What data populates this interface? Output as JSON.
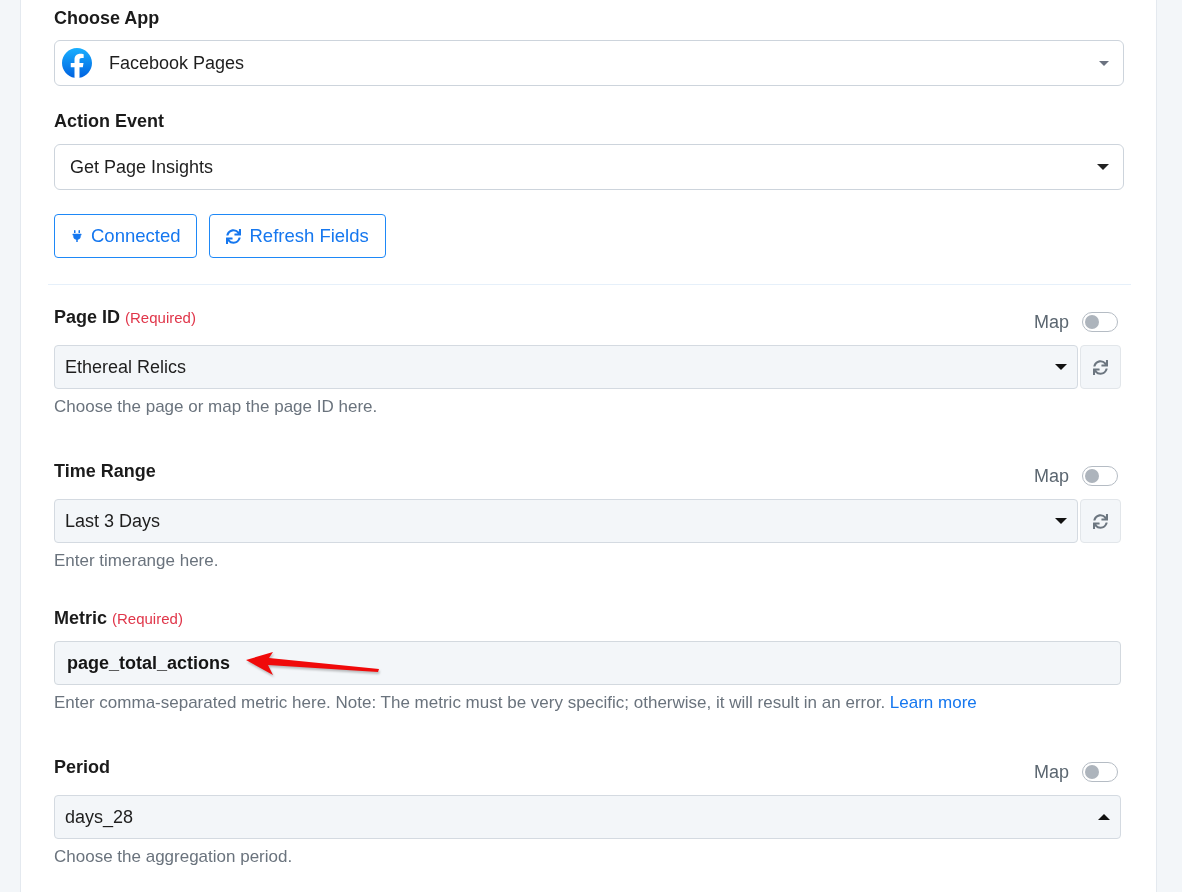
{
  "app_field": {
    "label": "Choose App",
    "value": "Facebook Pages"
  },
  "event_field": {
    "label": "Action Event",
    "value": "Get Page Insights"
  },
  "buttons": [
    {
      "kind": "plug",
      "label": "Connected"
    },
    {
      "kind": "refresh",
      "label": "Refresh Fields"
    }
  ],
  "fields": [
    {
      "kind": "select",
      "label": "Page ID",
      "required_note": "(Required)",
      "map": {
        "label": "Map",
        "on": false
      },
      "value": "Ethereal Relics",
      "expanded": false,
      "refresh_button": true,
      "help": "Choose the page or map the page ID here."
    },
    {
      "kind": "select",
      "label": "Time Range",
      "map": {
        "label": "Map",
        "on": false
      },
      "value": "Last 3 Days",
      "expanded": false,
      "refresh_button": true,
      "help": "Enter timerange here."
    },
    {
      "kind": "text",
      "label": "Metric",
      "required_note": "(Required)",
      "value": "page_total_actions",
      "arrow_annotation": true,
      "help": "Enter comma-separated metric here. Note: The metric must be very specific; otherwise, it will result in an error.",
      "help_link": "Learn more"
    },
    {
      "kind": "select",
      "label": "Period",
      "map": {
        "label": "Map",
        "on": false
      },
      "value": "days_28",
      "expanded": true,
      "refresh_button": false,
      "help": "Choose the aggregation period."
    }
  ]
}
